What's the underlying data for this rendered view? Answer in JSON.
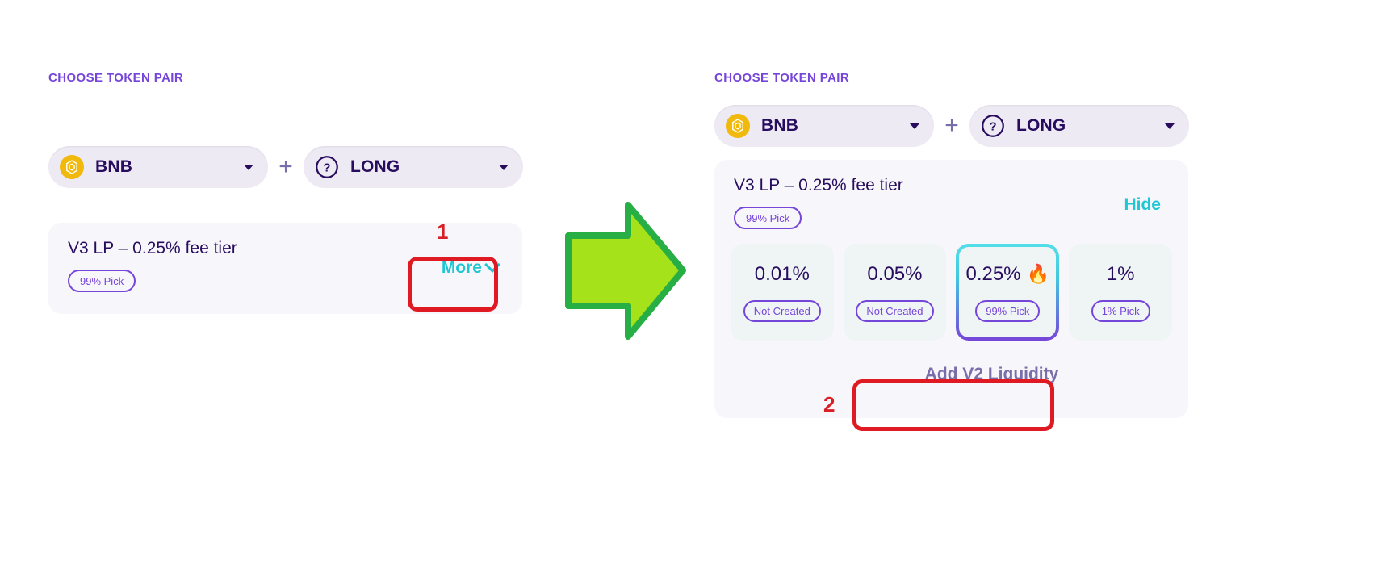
{
  "left_panel": {
    "section_title": "CHOOSE TOKEN PAIR",
    "token_a": {
      "label": "BNB",
      "icon": "bnb-token-icon",
      "caret": "chevron-down-icon"
    },
    "separator": "+",
    "token_b": {
      "label": "LONG",
      "icon": "unknown-token-icon",
      "caret": "chevron-down-icon"
    },
    "lp_card": {
      "title": "V3 LP – 0.25% fee tier",
      "badge": "99% Pick",
      "toggle_label": "More",
      "toggle_icon": "chevron-down-icon"
    },
    "annotation": {
      "number": "1"
    }
  },
  "right_panel": {
    "section_title": "CHOOSE TOKEN PAIR",
    "token_a": {
      "label": "BNB",
      "icon": "bnb-token-icon",
      "caret": "chevron-down-icon"
    },
    "separator": "+",
    "token_b": {
      "label": "LONG",
      "icon": "unknown-token-icon",
      "caret": "chevron-down-icon"
    },
    "lp_card": {
      "title": "V3 LP – 0.25% fee tier",
      "badge": "99% Pick",
      "toggle_label": "Hide",
      "fee_tiers": [
        {
          "value": "0.01%",
          "badge": "Not Created",
          "selected": false,
          "hot": false
        },
        {
          "value": "0.05%",
          "badge": "Not Created",
          "selected": false,
          "hot": false
        },
        {
          "value": "0.25%",
          "badge": "99% Pick",
          "selected": true,
          "hot": true,
          "hot_icon": "fire-emoji"
        },
        {
          "value": "1%",
          "badge": "1% Pick",
          "selected": false,
          "hot": false
        }
      ],
      "v2_button_label": "Add V2 Liquidity"
    },
    "annotation": {
      "number": "2"
    }
  },
  "transition_arrow": {
    "icon": "right-arrow-icon"
  },
  "colors": {
    "accent_purple": "#7645d9",
    "accent_teal": "#1fc7d4",
    "text_dark": "#280d5f",
    "text_muted": "#7a6eaa",
    "annotation_red": "#e01a22",
    "arrow_fill": "#a6e219",
    "arrow_stroke": "#27ae44",
    "token_pill_bg": "#eeeaf4",
    "card_bg": "#f7f6fa",
    "tier_bg": "#eff4f5"
  }
}
